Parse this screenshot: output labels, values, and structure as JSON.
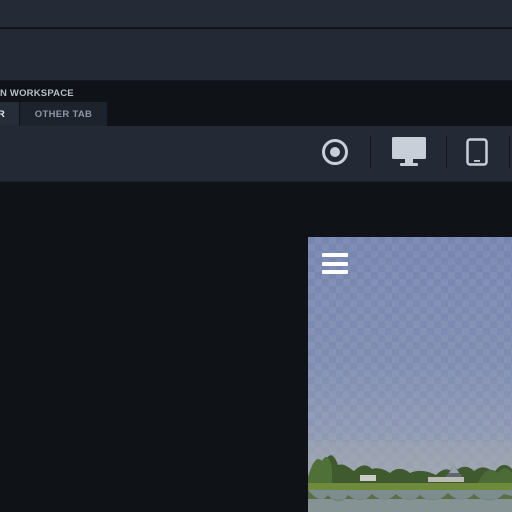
{
  "header": {},
  "workspace": {
    "label": "N WORKSPACE"
  },
  "tabs": [
    {
      "label": "R",
      "active": true
    },
    {
      "label": "OTHER TAB",
      "active": false
    }
  ],
  "toolbar": {
    "icons": [
      "target-icon",
      "desktop-icon",
      "tablet-icon"
    ]
  },
  "preview": {
    "menu_icon": "hamburger-menu-icon"
  },
  "colors": {
    "app_background": "#0f1216",
    "panel": "#232a36",
    "icon": "#c9cfd8",
    "preview_sky": "#7b89b0"
  }
}
